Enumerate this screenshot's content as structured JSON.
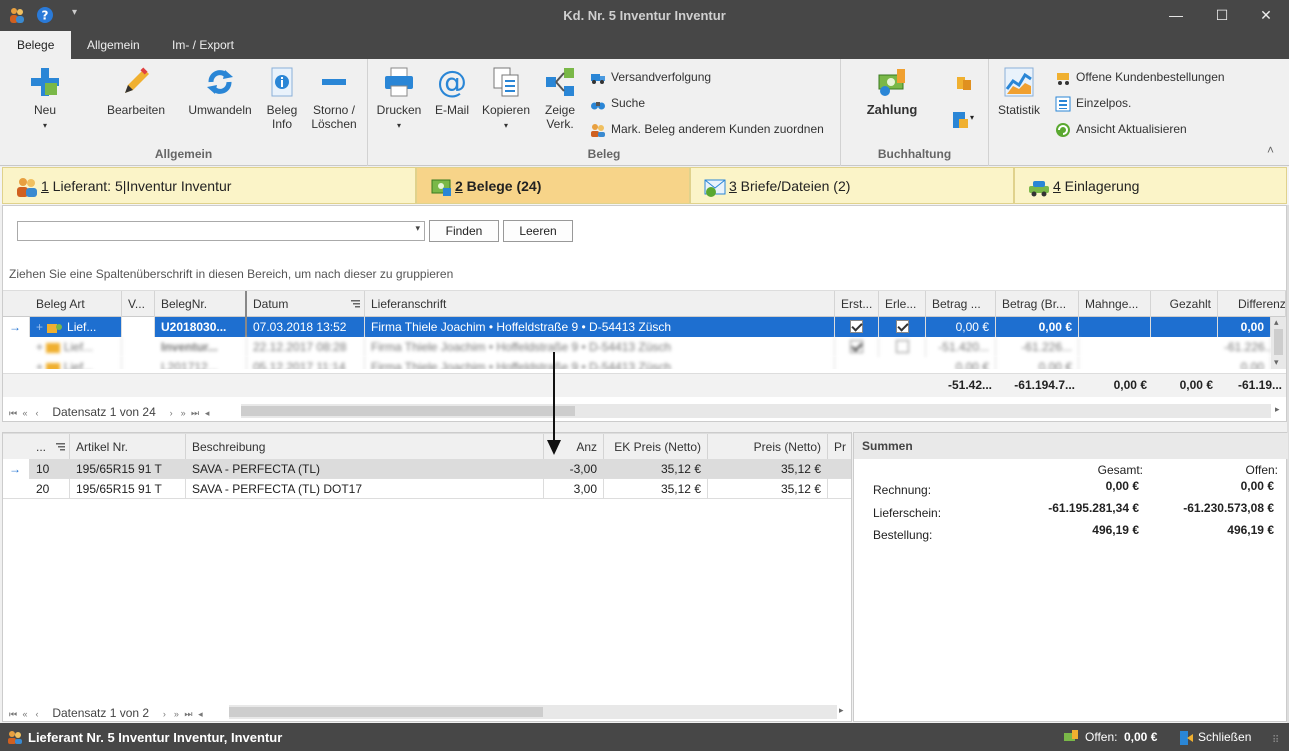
{
  "window": {
    "title": "Kd. Nr. 5 Inventur Inventur",
    "minimize": "—",
    "maximize": "☐",
    "close": "✕",
    "qa_dropdown": "▾"
  },
  "ribbon_tabs": [
    "Belege",
    "Allgemein",
    "Im- / Export"
  ],
  "ribbon": {
    "allgemein": {
      "label": "Allgemein",
      "neu": "Neu",
      "bearbeiten": "Bearbeiten",
      "umwandeln": "Umwandeln",
      "beleg_info_1": "Beleg",
      "beleg_info_2": "Info",
      "storno_1": "Storno /",
      "storno_2": "Löschen"
    },
    "beleg": {
      "label": "Beleg",
      "drucken": "Drucken",
      "email": "E-Mail",
      "kopieren": "Kopieren",
      "zeige_1": "Zeige",
      "zeige_2": "Verk.",
      "versand": "Versandverfolgung",
      "suche": "Suche",
      "mark": "Mark. Beleg  anderem Kunden zuordnen"
    },
    "buchhaltung": {
      "label": "Buchhaltung",
      "zahlung": "Zahlung"
    },
    "statistik": {
      "statistik": "Statistik",
      "offene": "Offene Kundenbestellungen",
      "einzelpos": "Einzelpos.",
      "ansicht": "Ansicht Aktualisieren"
    },
    "collapse": "˄"
  },
  "nav_tabs": [
    {
      "num": "1",
      "label": " Lieferant: 5|Inventur Inventur"
    },
    {
      "num": "2",
      "label": " Belege (24)"
    },
    {
      "num": "3",
      "label": " Briefe/Dateien (2)"
    },
    {
      "num": "4",
      "label": " Einlagerung"
    }
  ],
  "search": {
    "finden": "Finden",
    "leeren": "Leeren"
  },
  "group_hint": "Ziehen Sie eine Spaltenüberschrift in diesen Bereich, um nach dieser zu gruppieren",
  "main_grid": {
    "headers": [
      "Beleg Art",
      "V...",
      "BelegNr.",
      "Datum",
      "Lieferanschrift",
      "Erst...",
      "Erle...",
      "Betrag ...",
      "Betrag (Br...",
      "Mahnge...",
      "Gezahlt",
      "Differenz"
    ],
    "selected_row": {
      "art": "Lief...",
      "nr": "U2018030...",
      "datum": "07.03.2018 13:52",
      "anschrift": "Firma Thiele Joachim • Hoffeldstraße 9 • D-54413 Züsch",
      "betrag": "0,00 €",
      "betrag_br": "0,00 €",
      "differenz": "0,00"
    },
    "blurred_rows": [
      {
        "art": "Lief...",
        "nr": "Inventur...",
        "datum": "22.12.2017 08:28",
        "anschrift": "Firma Thiele Joachim • Hoffeldstraße 9 • D-54413 Züsch",
        "betrag": "-51.420...",
        "betrag_br": "-61.226...",
        "differenz": "-61.226..."
      },
      {
        "art": "Lief...",
        "nr": "L201712...",
        "datum": "05.12.2017 11:14",
        "anschrift": "Firma Thiele Joachim • Hoffeldstraße 9 • D-54413 Züsch",
        "betrag": "0,00 €",
        "betrag_br": "0,00 €",
        "differenz": "0,00"
      }
    ],
    "footer": {
      "betrag": "-51.42...",
      "betrag_br": "-61.194.7...",
      "mahn": "0,00 €",
      "gezahlt": "0,00 €",
      "differenz": "-61.19..."
    },
    "record_nav": "Datensatz 1 von 24"
  },
  "detail_grid": {
    "headers": [
      "...",
      "Artikel Nr.",
      "Beschreibung",
      "Anz",
      "EK Preis (Netto)",
      "Preis (Netto)",
      "Pr"
    ],
    "rows": [
      {
        "pos": "10",
        "artikel": "195/65R15 91 T",
        "beschreibung": "SAVA - PERFECTA (TL)",
        "anz": "-3,00",
        "ek": "35,12 €",
        "preis": "35,12 €"
      },
      {
        "pos": "20",
        "artikel": "195/65R15 91 T",
        "beschreibung": "SAVA - PERFECTA (TL) DOT17",
        "anz": "3,00",
        "ek": "35,12 €",
        "preis": "35,12 €"
      }
    ],
    "record_nav": "Datensatz 1 von 2"
  },
  "summen": {
    "title": "Summen",
    "col_gesamt": "Gesamt:",
    "col_offen": "Offen:",
    "row0_gesamt": "0,00 €",
    "row0_offen": "0,00 €",
    "rows": [
      {
        "label": "Rechnung:"
      },
      {
        "label": "Lieferschein:",
        "gesamt": "-61.195.281,34 €",
        "offen": "-61.230.573,08 €"
      },
      {
        "label": "Bestellung:",
        "gesamt": "496,19 €",
        "offen": "496,19 €"
      }
    ]
  },
  "status": {
    "left": "Lieferant Nr. 5 Inventur Inventur, Inventur",
    "offen": "Offen: ",
    "offen_val": "0,00 €",
    "schliessen": "Schließen"
  },
  "nav_glyphs": {
    "first": "⏮",
    "prev2": "«",
    "prev": "‹",
    "next": "›",
    "next2": "»",
    "last": "⏭",
    "arrow": "→",
    "plus": "+",
    "drop": "▾",
    "scroll_left": "◂",
    "scroll_right": "▸",
    "scroll_up": "▴",
    "scroll_down": "▾",
    "resize": "⠿"
  }
}
